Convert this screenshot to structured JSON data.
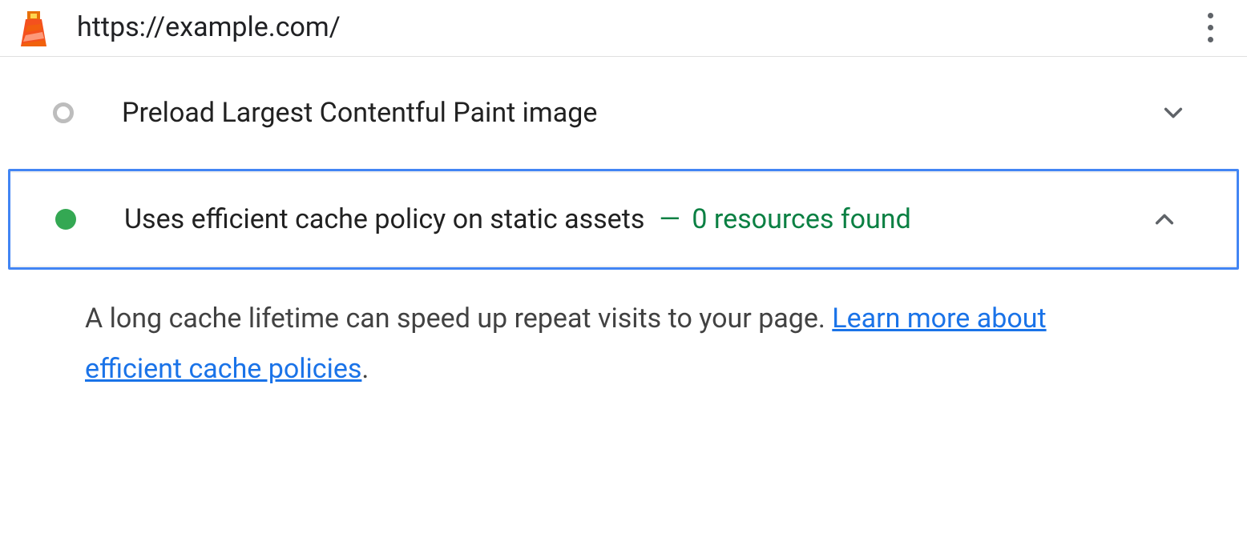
{
  "header": {
    "url": "https://example.com/"
  },
  "audits": [
    {
      "status": "neutral",
      "title": "Preload Largest Contentful Paint image",
      "expanded": false
    },
    {
      "status": "pass",
      "title": "Uses efficient cache policy on static assets",
      "result_dash": "—",
      "result_text": "0 resources found",
      "expanded": true,
      "selected": true
    }
  ],
  "description": {
    "text": "A long cache lifetime can speed up repeat visits to your page. ",
    "link_text": "Learn more about efficient cache policies",
    "period": "."
  },
  "colors": {
    "pass": "#34a853",
    "pass_text": "#0b8043",
    "link": "#1a73e8",
    "selected_border": "#4285f4",
    "neutral_ring": "#bdbdbd"
  }
}
